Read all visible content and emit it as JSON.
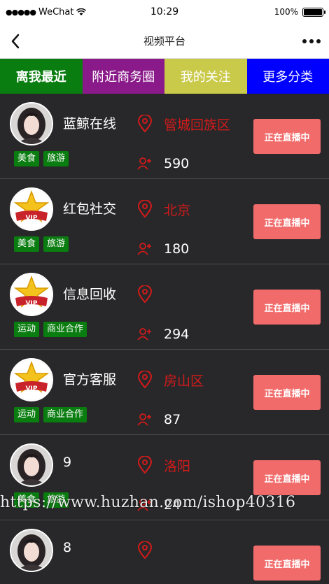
{
  "status_bar": {
    "carrier": "WeChat",
    "time": "10:29",
    "battery": "100%"
  },
  "nav": {
    "title": "视频平台"
  },
  "tabs": [
    {
      "label": "离我最近",
      "color": "#0a7d10"
    },
    {
      "label": "附近商务圈",
      "color": "#8a1a8a"
    },
    {
      "label": "我的关注",
      "color": "#c9c94a"
    },
    {
      "label": "更多分类",
      "color": "#0000ff"
    }
  ],
  "rows": [
    {
      "name": "蓝鲸在线",
      "avatar": "girl",
      "tags": [
        "美食",
        "旅游"
      ],
      "location": "管城回族区",
      "fans": "590",
      "button": "正在直播中"
    },
    {
      "name": "红包社交",
      "avatar": "vip",
      "tags": [
        "美食",
        "旅游"
      ],
      "location": "北京",
      "fans": "180",
      "button": "正在直播中"
    },
    {
      "name": "信息回收",
      "avatar": "vip",
      "tags": [
        "运动",
        "商业合作"
      ],
      "location": "",
      "fans": "294",
      "button": "正在直播中"
    },
    {
      "name": "官方客服",
      "avatar": "vip",
      "tags": [
        "运动",
        "商业合作"
      ],
      "location": "房山区",
      "fans": "87",
      "button": "正在直播中"
    },
    {
      "name": "9",
      "avatar": "girl",
      "tags": [
        "美食",
        "旅游"
      ],
      "location": "洛阳",
      "fans": "24",
      "button": "正在直播中"
    },
    {
      "name": "8",
      "avatar": "girl",
      "tags": [],
      "location": "",
      "fans": "",
      "button": "正在直播中"
    }
  ],
  "watermark": "https://www.huzhan.com/ishop40316",
  "colors": {
    "accent": "#f26b6b",
    "tag": "#0a7d10",
    "location": "#d21a1a"
  }
}
